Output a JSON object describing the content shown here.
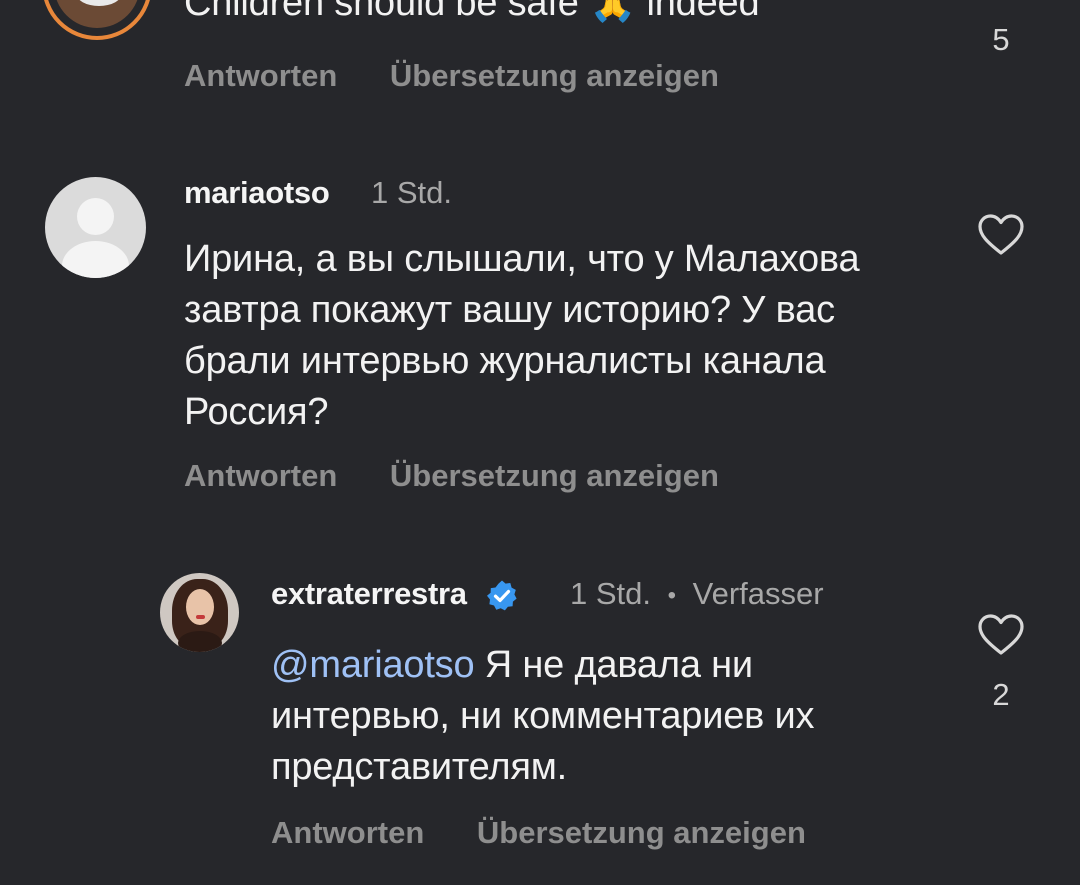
{
  "comments": [
    {
      "text": "Children should be safe 🙏 indeed",
      "actions": {
        "reply": "Antworten",
        "translate": "Übersetzung anzeigen"
      },
      "likes": "5"
    },
    {
      "username": "mariaotso",
      "time": "1 Std.",
      "text": "Ирина, а вы слышали, что у Малахова завтра покажут вашу историю? У вас брали интервью журналисты канала Россия?",
      "actions": {
        "reply": "Antworten",
        "translate": "Übersetzung anzeigen"
      }
    },
    {
      "username": "extraterrestra",
      "time": "1 Std.",
      "separator": "•",
      "author_badge": "Verfasser",
      "mention": "@mariaotso",
      "text": "Я не давала ни интервью, ни комментариев их представителям.",
      "actions": {
        "reply": "Antworten",
        "translate": "Übersetzung anzeigen"
      },
      "likes": "2"
    }
  ],
  "icons": {
    "like": "heart-outline-icon",
    "verified": "verified-badge-icon",
    "avatar_placeholder": "default-avatar-icon"
  },
  "colors": {
    "background": "#26272b",
    "mention": "#9fc1f5",
    "verified": "#3897f0",
    "secondary_text": "#8e8e8e"
  }
}
